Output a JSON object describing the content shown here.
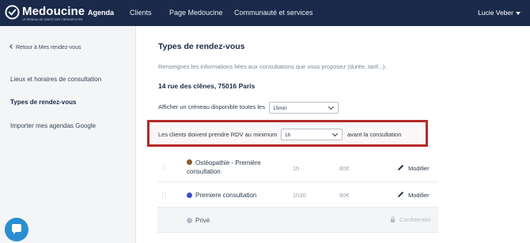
{
  "header": {
    "brand_name": "Medoucine",
    "brand_tagline": "LE RÉSEAU DE SANTÉ DES THÉRAPEUTES",
    "nav": [
      {
        "label": "Agenda",
        "active": true
      },
      {
        "label": "Clients",
        "active": false
      },
      {
        "label": "Page Medoucine",
        "active": false
      },
      {
        "label": "Communauté et services",
        "active": false
      }
    ],
    "user_name": "Lucie Veber",
    "brand_color": "#1b2a4a"
  },
  "sidebar": {
    "back_link": "Retour à Mes rendez-vous",
    "items": [
      {
        "label": "Lieux et horaires de consultation",
        "active": false
      },
      {
        "label": "Types de rendez-vous",
        "active": true
      },
      {
        "label": "Importer mes agendas Google",
        "active": false
      }
    ]
  },
  "main": {
    "title": "Types de rendez-vous",
    "description": "Renseignez les informations liées aux consultations que vous proposez (durée, tarif...).",
    "address": "14 rue des clênes, 75016 Paris",
    "slot_interval": {
      "label": "Afficher un créneau disponible toutes les",
      "value": "15min"
    },
    "min_booking": {
      "label": "Les clients doivent prendre RDV au minimum",
      "value": "1h",
      "suffix": "avant la consultation",
      "highlight_color": "#b52a2a"
    },
    "appointments": [
      {
        "name_line1": "Ostéopathie - Première",
        "name_line2": "consultation",
        "duration": "1h",
        "price": "80€",
        "action": "Modifier",
        "color": "#8a5a2b",
        "icon": "pencil-icon"
      },
      {
        "name_line1": "Premiere consultation",
        "name_line2": "",
        "duration": "1h30",
        "price": "80€",
        "action": "Modifier",
        "color": "#3b4fc8",
        "icon": "pencil-icon"
      },
      {
        "name_line1": "Privé",
        "name_line2": "",
        "duration": "",
        "price": "",
        "action": "Confidentiel",
        "color": "#b5bcc6",
        "icon": "lock-icon"
      }
    ]
  },
  "chat": {
    "icon": "chat-icon",
    "color": "#2a8fd0"
  }
}
